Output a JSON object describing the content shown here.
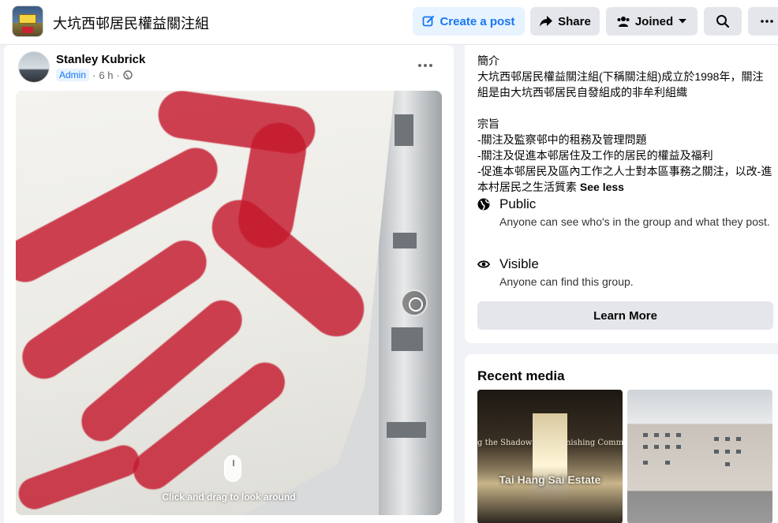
{
  "header": {
    "group_name": "大坑西邨居民權益關注組",
    "create_post_label": "Create a post",
    "share_label": "Share",
    "joined_label": "Joined"
  },
  "post": {
    "author": "Stanley Kubrick",
    "role_badge": "Admin",
    "time": "6 h",
    "separator": "·",
    "drag_hint": "Click and drag to look around"
  },
  "about": {
    "text": "簡介\n大坑西邨居民權益關注組(下稱關注組)成立於1998年，關注組是由大坑西邨居民自發組成的非牟利組織\n\n宗旨\n-關注及監察邨中的租務及管理問題\n-關注及促進本邨居住及工作的居民的權益及福利\n-促進本邨居民及區內工作之人士對本區事務之關注，以改-進本村居民之生活質素 ",
    "see_less_label": "See less",
    "privacy": {
      "title": "Public",
      "description": "Anyone can see who's in the group and what they post."
    },
    "visibility": {
      "title": "Visible",
      "description": "Anyone can find this group."
    },
    "learn_more_label": "Learn More"
  },
  "media": {
    "title": "Recent media",
    "items": [
      {
        "caption_top": "g the Shadows of a Vanishing Comm",
        "caption_main": "Tai Hang Sai Estate"
      }
    ]
  },
  "colors": {
    "accent": "#1877f2",
    "accent_bg": "#e7f3ff",
    "button_bg": "#e4e6eb",
    "page_bg": "#f0f2f5"
  },
  "icons": [
    "edit-icon",
    "share-icon",
    "group-icon",
    "chevron-down-icon",
    "search-icon",
    "more-icon",
    "globe-icon",
    "eye-icon",
    "panorama-icon",
    "mouse-icon"
  ]
}
